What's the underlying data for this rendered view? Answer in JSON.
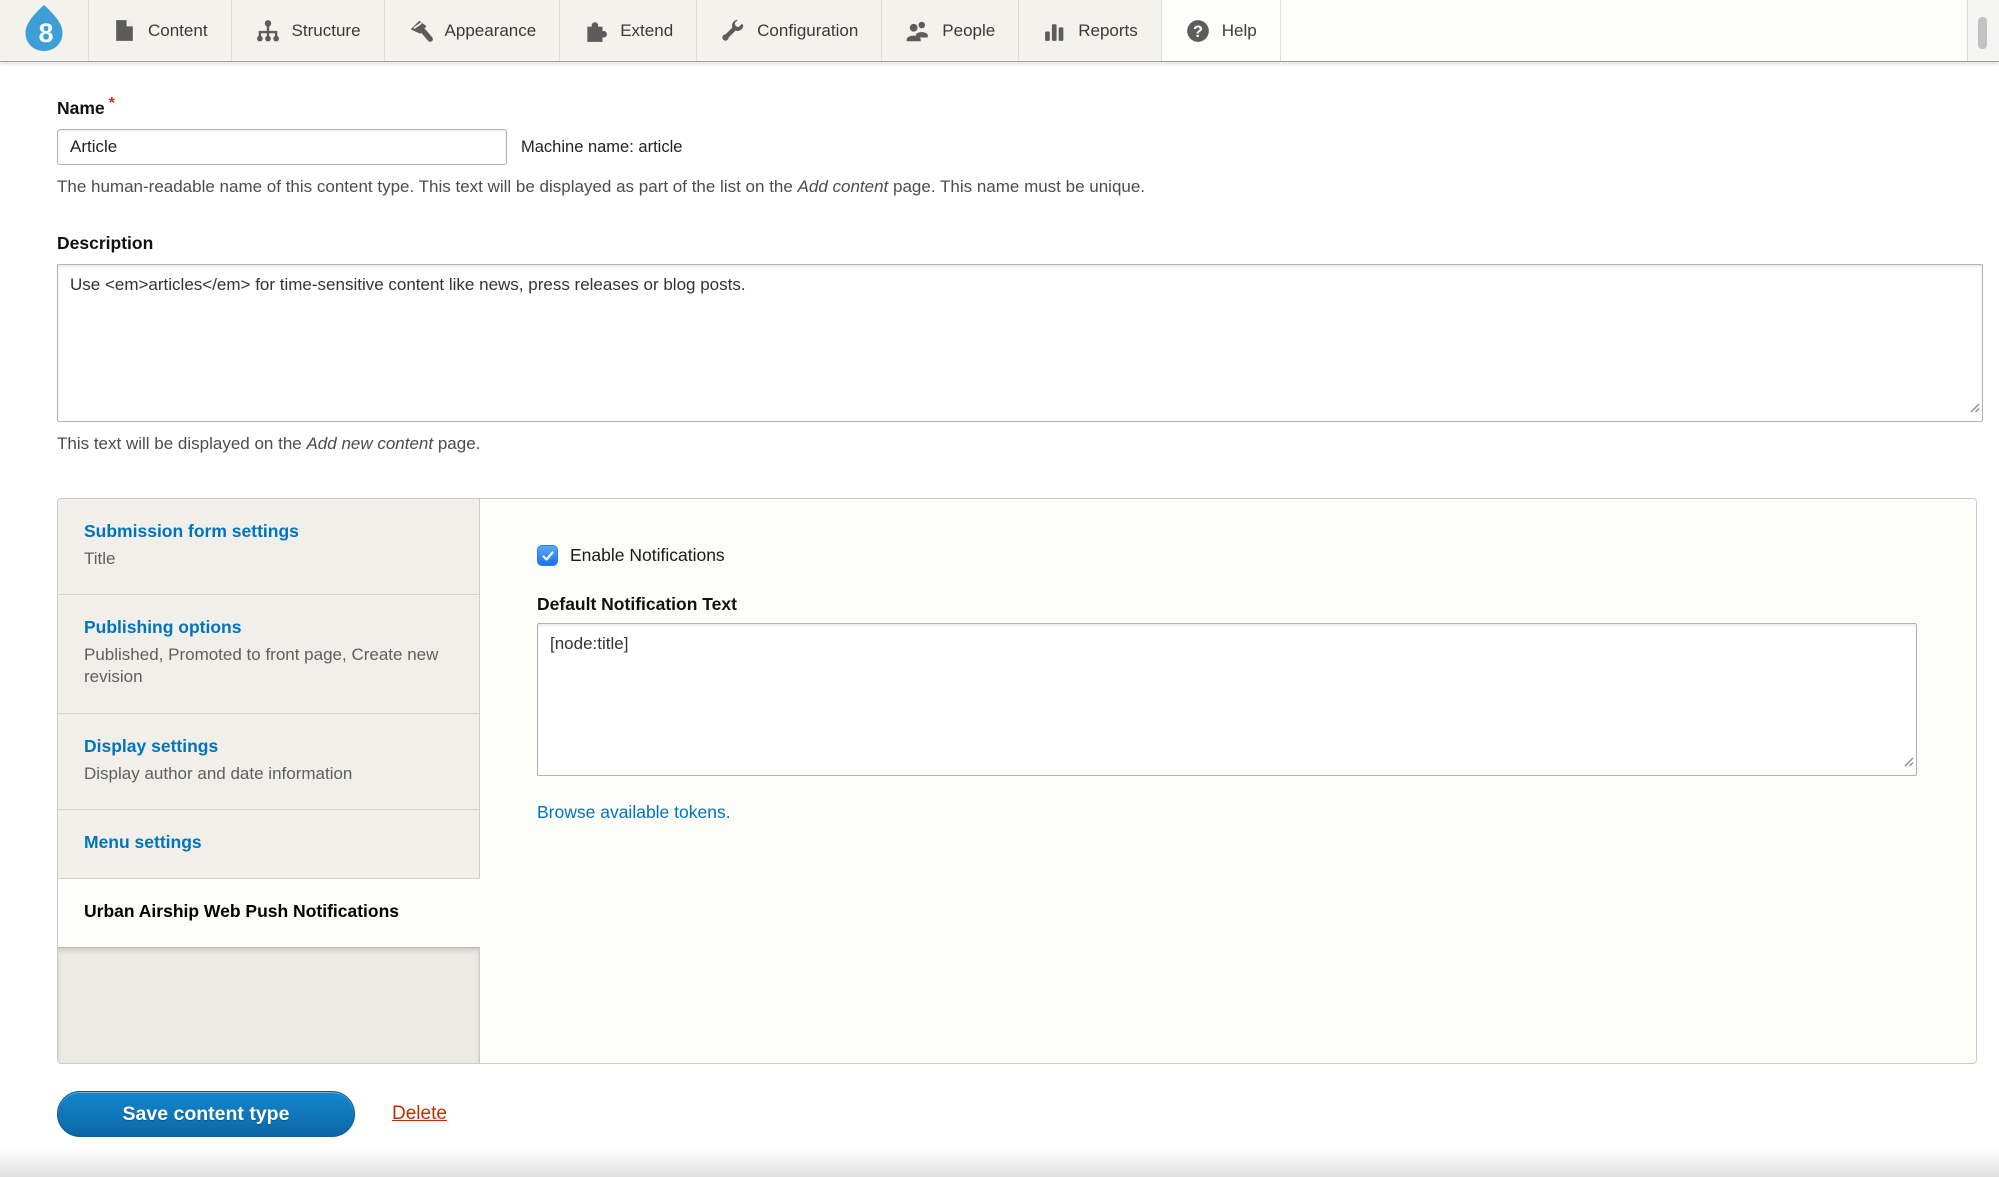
{
  "toolbar": {
    "items": [
      {
        "label": "Content",
        "icon": "file-icon"
      },
      {
        "label": "Structure",
        "icon": "sitemap-icon"
      },
      {
        "label": "Appearance",
        "icon": "paintbrush-icon"
      },
      {
        "label": "Extend",
        "icon": "puzzle-icon"
      },
      {
        "label": "Configuration",
        "icon": "wrench-icon"
      },
      {
        "label": "People",
        "icon": "people-icon"
      },
      {
        "label": "Reports",
        "icon": "bar-chart-icon"
      },
      {
        "label": "Help",
        "icon": "help-icon"
      }
    ]
  },
  "form": {
    "name": {
      "label": "Name",
      "required_marker": "*",
      "value": "Article",
      "machine_name": "Machine name: article",
      "help_prefix": "The human-readable name of this content type. This text will be displayed as part of the list on the ",
      "help_italic": "Add content",
      "help_suffix": " page. This name must be unique."
    },
    "description": {
      "label": "Description",
      "value": "Use <em>articles</em> for time-sensitive content like news, press releases or blog posts.",
      "help_prefix": "This text will be displayed on the ",
      "help_italic": "Add new content",
      "help_suffix": " page."
    },
    "vertical_tabs": [
      {
        "title": "Submission form settings",
        "summary": "Title",
        "active": false
      },
      {
        "title": "Publishing options",
        "summary": "Published, Promoted to front page, Create new revision",
        "active": false
      },
      {
        "title": "Display settings",
        "summary": "Display author and date information",
        "active": false
      },
      {
        "title": "Menu settings",
        "summary": "",
        "active": false
      },
      {
        "title": "Urban Airship Web Push Notifications",
        "summary": "",
        "active": true
      }
    ],
    "notifications_pane": {
      "checkbox_label": "Enable Notifications",
      "checkbox_checked": true,
      "text_label": "Default Notification Text",
      "text_value": "[node:title]",
      "tokens_link": "Browse available tokens."
    },
    "actions": {
      "save_label": "Save content type",
      "delete_label": "Delete"
    }
  },
  "colors": {
    "toolbar_bg": "#f3f2ec",
    "link_blue": "#0074bd",
    "logo_blue": "#3d9fd6",
    "button_blue": "#0d73b5",
    "delete_red": "#c02c02",
    "required_red": "#e7251b",
    "checkbox_blue": "#1d70ea"
  }
}
